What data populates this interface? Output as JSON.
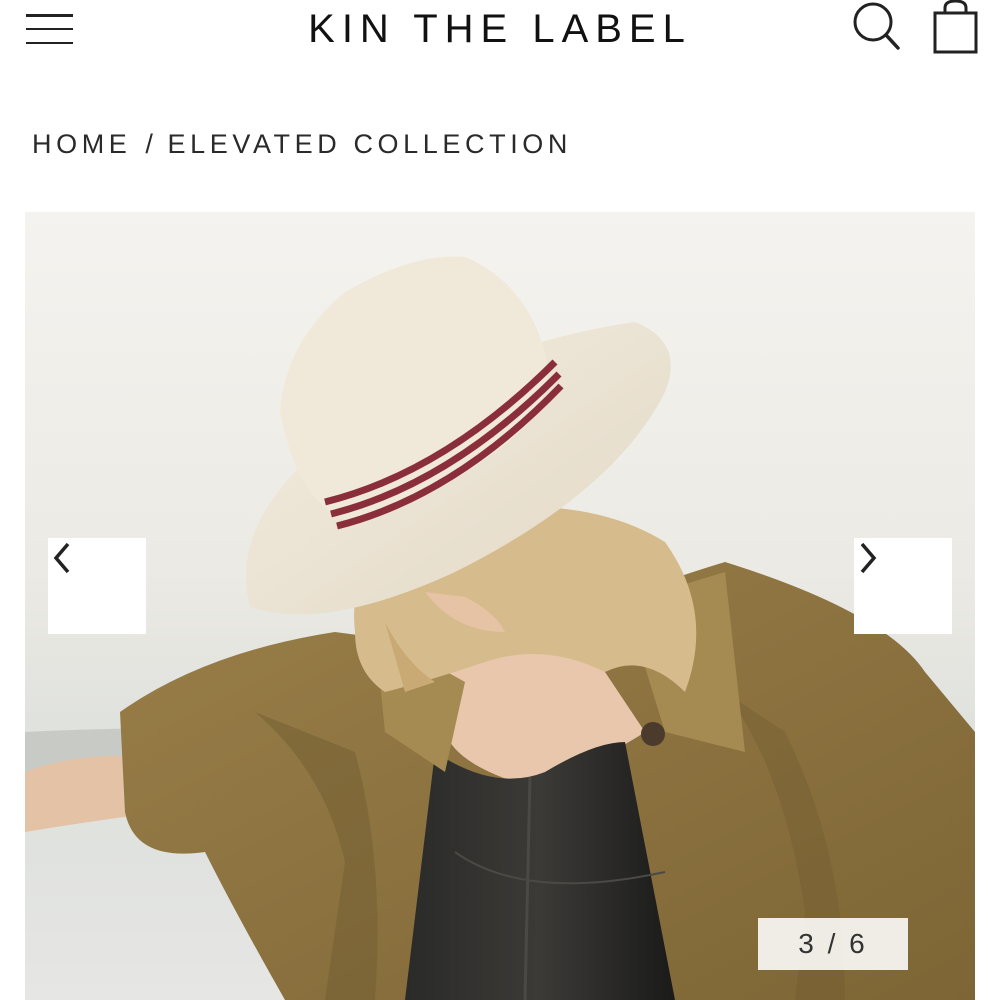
{
  "header": {
    "brand": "KIN THE LABEL",
    "menu_icon": "hamburger-menu-icon",
    "search_icon": "search-icon",
    "cart_icon": "shopping-bag-icon"
  },
  "breadcrumb": {
    "home": "HOME",
    "separator": "/",
    "current": "ELEVATED COLLECTION"
  },
  "gallery": {
    "image_alt": "Model wearing a straw fedora with burgundy stripe band and an olive utility shirt over a black leather bustier",
    "prev_icon": "chevron-left-icon",
    "next_icon": "chevron-right-icon",
    "counter": "3 / 6",
    "current_index": 3,
    "total": 6
  },
  "colors": {
    "hat": "#ede4d3",
    "hat_band": "#8a2e3a",
    "shirt": "#8d7440",
    "top": "#1c1c1c",
    "hair": "#d6bc8c",
    "skin": "#e8c7ac"
  }
}
